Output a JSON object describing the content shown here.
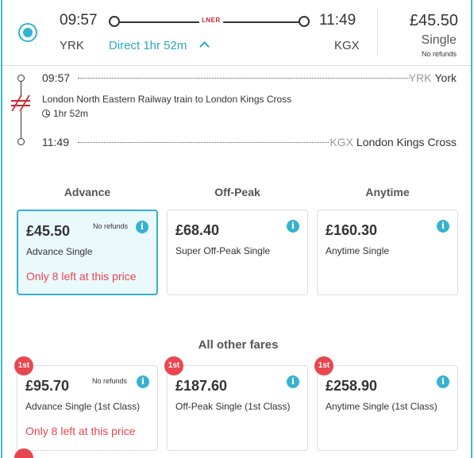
{
  "journey": {
    "departure_time": "09:57",
    "arrival_time": "11:49",
    "departure_code": "YRK",
    "arrival_code": "KGX",
    "operator_logo": "LNER",
    "direct_label": "Direct 1hr 52m",
    "price": "£45.50",
    "ticket_type": "Single",
    "refund_note": "No refunds"
  },
  "details": {
    "stops": [
      {
        "time": "09:57",
        "code": "YRK",
        "name": "York"
      },
      {
        "time": "11:49",
        "code": "KGX",
        "name": "London Kings Cross"
      }
    ],
    "service": "London North Eastern Railway train to London Kings Cross",
    "duration": "1hr 52m"
  },
  "columns": [
    "Advance",
    "Off-Peak",
    "Anytime"
  ],
  "standard_fares": [
    {
      "price": "£45.50",
      "name": "Advance Single",
      "no_refund": "No refunds",
      "warning": "Only 8 left at this price",
      "selected": true
    },
    {
      "price": "£68.40",
      "name": "Super Off-Peak Single",
      "no_refund": "",
      "warning": "",
      "selected": false
    },
    {
      "price": "£160.30",
      "name": "Anytime Single",
      "no_refund": "",
      "warning": "",
      "selected": false
    }
  ],
  "other_title": "All other fares",
  "first_badge": "1st",
  "other_fares": [
    {
      "price": "£95.70",
      "name": "Advance Single (1st Class)",
      "no_refund": "No refunds",
      "warning": "Only 8 left at this price"
    },
    {
      "price": "£187.60",
      "name": "Off-Peak Single (1st Class)",
      "no_refund": "",
      "warning": ""
    },
    {
      "price": "£258.90",
      "name": "Anytime Single (1st Class)",
      "no_refund": "",
      "warning": ""
    }
  ],
  "colors": {
    "accent": "#2fb5cf",
    "warning": "#e8474f",
    "brand": "#d0262f"
  },
  "icons": {
    "info": "info-icon",
    "clock": "clock-icon",
    "rail": "national-rail-icon"
  }
}
